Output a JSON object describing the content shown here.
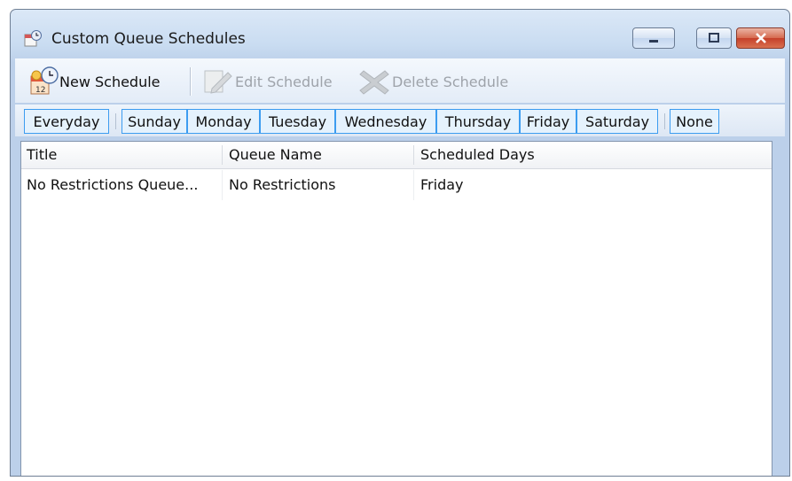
{
  "window": {
    "title": "Custom Queue Schedules",
    "icon": "calendar-schedule-icon",
    "buttons": [
      "minimize-icon",
      "maximize-icon",
      "close-icon"
    ]
  },
  "toolbar": {
    "new_label": "New Schedule",
    "edit_label": "Edit Schedule",
    "delete_label": "Delete Schedule"
  },
  "days": {
    "everyday": "Everyday",
    "sunday": "Sunday",
    "monday": "Monday",
    "tuesday": "Tuesday",
    "wednesday": "Wednesday",
    "thursday": "Thursday",
    "friday": "Friday",
    "saturday": "Saturday",
    "none": "None"
  },
  "grid": {
    "columns": [
      "Title",
      "Queue Name",
      "Scheduled Days"
    ],
    "rows": [
      [
        "No Restrictions Queue...",
        "No Restrictions",
        "Friday"
      ]
    ]
  },
  "colors": {
    "day_border": "#3c9cf0",
    "day_fill": "#e5f2fd",
    "close_button": "#c5402a"
  }
}
